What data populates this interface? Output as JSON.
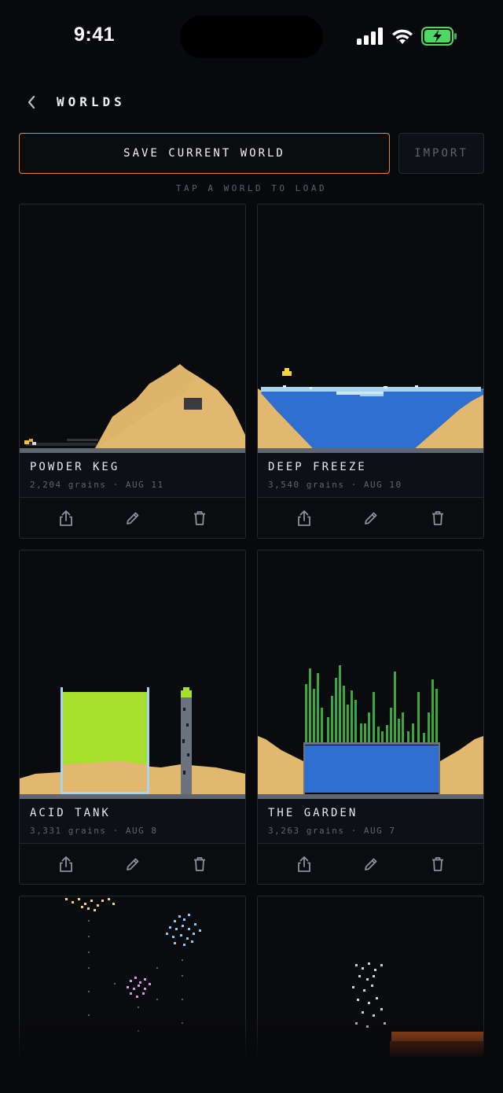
{
  "status_bar": {
    "time": "9:41",
    "icons": [
      "cellular-signal-icon",
      "wifi-icon",
      "battery-charging-icon"
    ],
    "battery_color": "#4cd964"
  },
  "header": {
    "back_icon": "chevron-left-icon",
    "title": "WORLDS"
  },
  "actions": {
    "save_label": "SAVE CURRENT WORLD",
    "import_label": "IMPORT",
    "hint": "TAP A WORLD TO LOAD"
  },
  "colors": {
    "accent": "#e0863a",
    "background": "#08090c",
    "card_border": "#262a33",
    "sand": "#e2b76f",
    "water": "#2f6fd0",
    "ice": "#a9d4ef",
    "acid": "#a6e02c",
    "plant": "#3aa63e"
  },
  "worlds": [
    {
      "name": "POWDER KEG",
      "grains": "2,204 grains",
      "date": "AUG 11",
      "thumbnail": "sand-pile-with-gunpowder"
    },
    {
      "name": "DEEP FREEZE",
      "grains": "3,540 grains",
      "date": "AUG 10",
      "thumbnail": "water-basin-with-ice"
    },
    {
      "name": "ACID TANK",
      "grains": "3,331 grains",
      "date": "AUG 8",
      "thumbnail": "glass-tank-of-acid"
    },
    {
      "name": "THE GARDEN",
      "grains": "3,263 grains",
      "date": "AUG 7",
      "thumbnail": "plants-over-water-pool"
    },
    {
      "name": "",
      "grains": "",
      "date": "",
      "thumbnail": "fireworks"
    },
    {
      "name": "",
      "grains": "",
      "date": "",
      "thumbnail": "sparks-over-lava"
    }
  ],
  "card_actions": {
    "share_icon": "share-icon",
    "edit_icon": "pencil-icon",
    "delete_icon": "trash-icon",
    "separator": "·"
  }
}
